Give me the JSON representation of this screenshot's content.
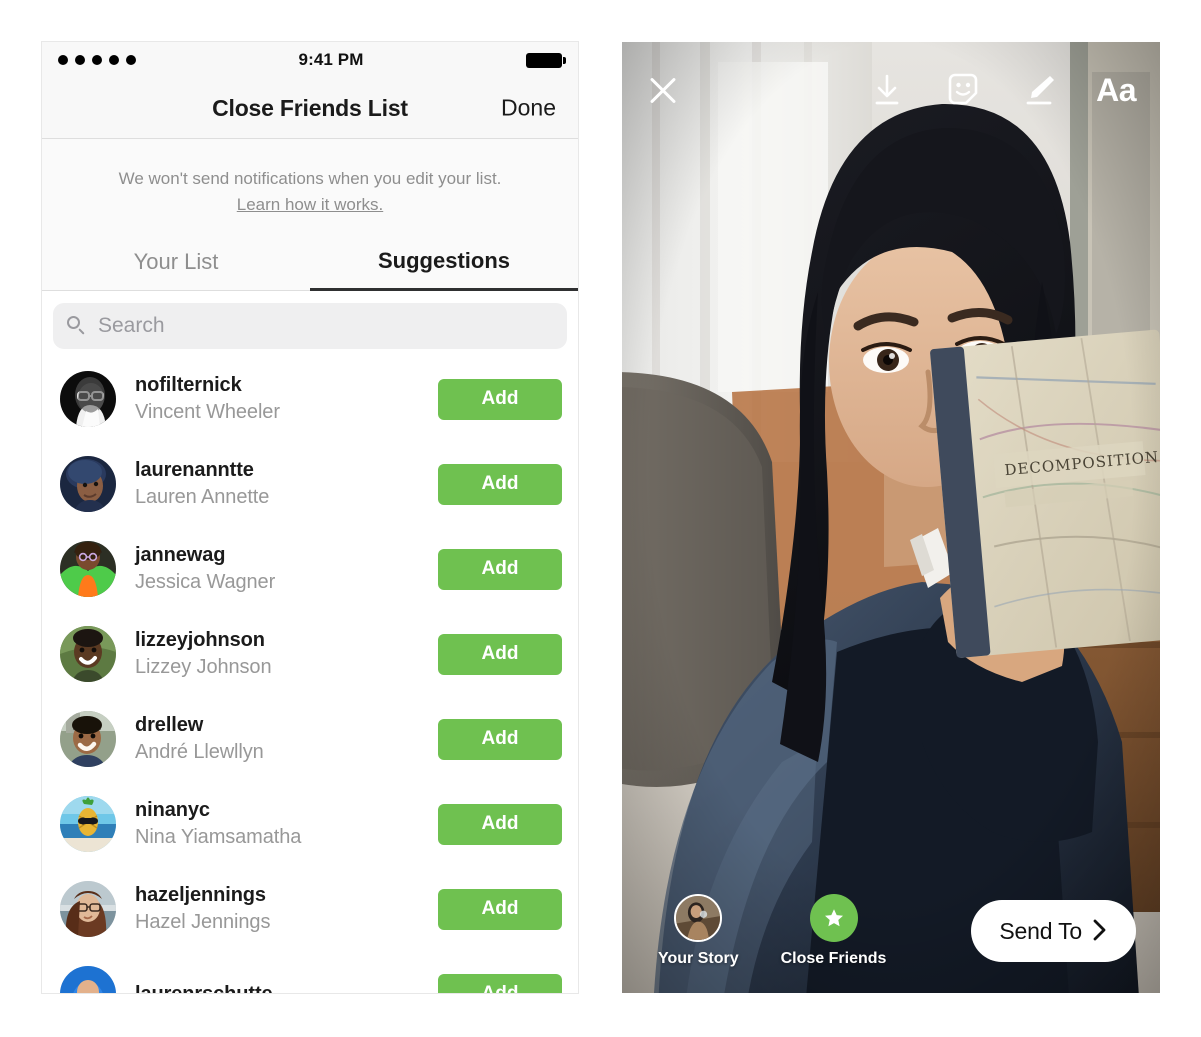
{
  "left_phone": {
    "status_bar": {
      "signal_dots": 5,
      "time": "9:41 PM",
      "battery_icon": "battery-full-icon"
    },
    "nav": {
      "title": "Close Friends List",
      "done_label": "Done"
    },
    "notice": {
      "text": "We won't send notifications when you edit your list.",
      "link_label": "Learn how it works."
    },
    "tabs": [
      {
        "label": "Your List",
        "active": false
      },
      {
        "label": "Suggestions",
        "active": true
      }
    ],
    "search": {
      "placeholder": "Search",
      "value": "",
      "icon": "search-icon"
    },
    "add_button_label": "Add",
    "suggestions": [
      {
        "username": "nofilternick",
        "fullname": "Vincent Wheeler",
        "action": "Add"
      },
      {
        "username": "laurenanntte",
        "fullname": "Lauren Annette",
        "action": "Add"
      },
      {
        "username": "jannewag",
        "fullname": "Jessica Wagner",
        "action": "Add"
      },
      {
        "username": "lizzeyjohnson",
        "fullname": "Lizzey Johnson",
        "action": "Add"
      },
      {
        "username": "drellew",
        "fullname": "André Llewllyn",
        "action": "Add"
      },
      {
        "username": "ninanyc",
        "fullname": "Nina Yiamsamatha",
        "action": "Add"
      },
      {
        "username": "hazeljennings",
        "fullname": "Hazel Jennings",
        "action": "Add"
      },
      {
        "username": "laurenrschutte",
        "fullname": "",
        "action": "Add"
      }
    ]
  },
  "right_phone": {
    "toolbar": {
      "close_icon": "close-icon",
      "save_icon": "download-icon",
      "sticker_icon": "sticker-face-icon",
      "draw_icon": "marker-pen-icon",
      "text_label": "Aa"
    },
    "bottom_bar": {
      "your_story_label": "Your Story",
      "close_friends_label": "Close Friends",
      "send_to_label": "Send To",
      "send_to_chevron": "chevron-right-icon"
    }
  },
  "colors": {
    "accent_green": "#6fc150",
    "text_primary": "#1b1b1b",
    "text_secondary": "#989898",
    "chrome_bg": "#fafafa",
    "search_bg": "#efeff0"
  }
}
